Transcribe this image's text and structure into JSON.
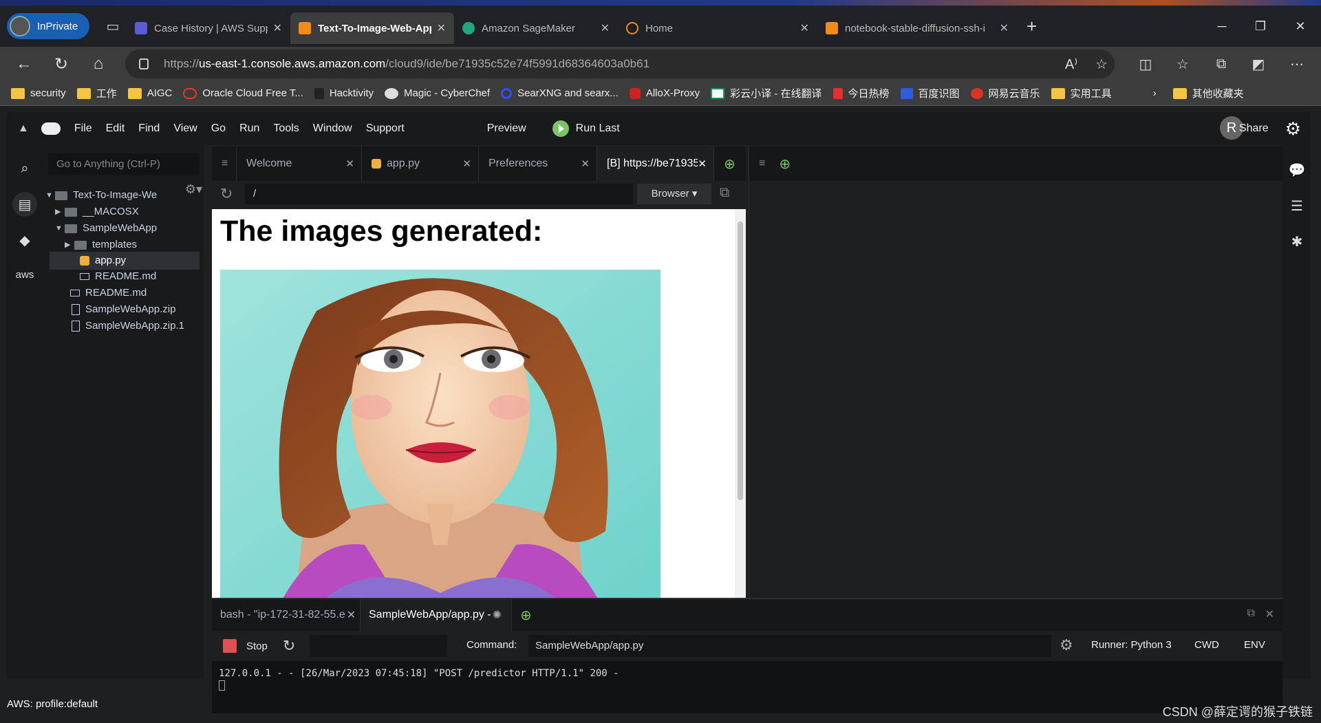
{
  "browser": {
    "inprivate_label": "InPrivate",
    "tabs": [
      {
        "title": "Case History | AWS Support Con",
        "color": "#5b5bd6"
      },
      {
        "title": "Text-To-Image-Web-App - AWS",
        "color": "#f08b1c"
      },
      {
        "title": "Amazon SageMaker",
        "color": "#1fa784"
      },
      {
        "title": "Home",
        "color": "#f08b1c"
      },
      {
        "title": "notebook-stable-diffusion-ssh-i",
        "color": "#f08b1c"
      }
    ],
    "url_prefix": "https://",
    "url_host": "us-east-1.console.aws.amazon.com",
    "url_path": "/cloud9/ide/be71935c52e74f5991d68364603a0b61",
    "bookmarks": [
      "security",
      "工作",
      "AIGC",
      "Oracle Cloud Free T...",
      "Hacktivity",
      "Magic - CyberChef",
      "SearXNG and searx...",
      "AlloX-Proxy",
      "彩云小译 - 在线翻译",
      "今日热榜",
      "百度识图",
      "网易云音乐",
      "实用工具"
    ],
    "other_bookmarks": "其他收藏夹"
  },
  "ide": {
    "menu": [
      "File",
      "Edit",
      "Find",
      "View",
      "Go",
      "Run",
      "Tools",
      "Window",
      "Support"
    ],
    "preview": "Preview",
    "run_last": "Run Last",
    "avatar_letter": "R",
    "share": "Share",
    "goto_placeholder": "Go to Anything (Ctrl-P)",
    "tree": {
      "root": "Text-To-Image-We",
      "macosx": "__MACOSX",
      "samplewebapp": "SampleWebApp",
      "templates": "templates",
      "app_py": "app.py",
      "readme_inner": "README.md",
      "readme": "README.md",
      "zip": "SampleWebApp.zip",
      "zip1": "SampleWebApp.zip.1"
    },
    "editor_tabs": [
      "Welcome",
      "app.py",
      "Preferences",
      "[B] https://be71935"
    ],
    "preview_url": "/",
    "browser_btn": "Browser",
    "preview_title": "The images generated:",
    "terminal_tabs": [
      "bash - \"ip-172-31-82-55.e",
      "SampleWebApp/app.py - "
    ],
    "stop": "Stop",
    "command_label": "Command:",
    "command_value": "SampleWebApp/app.py",
    "runner": "Runner: Python 3",
    "cwd": "CWD",
    "env": "ENV",
    "log_line": "127.0.0.1 - - [26/Mar/2023 07:45:18] \"POST /predictor HTTP/1.1\" 200 -",
    "status": "AWS: profile:default"
  },
  "watermark": "CSDN @薛定谔的猴子铁链",
  "colors": {
    "run_green": "#7dc466",
    "stop_red": "#e05055",
    "accent_blue": "#1a5fb4"
  }
}
